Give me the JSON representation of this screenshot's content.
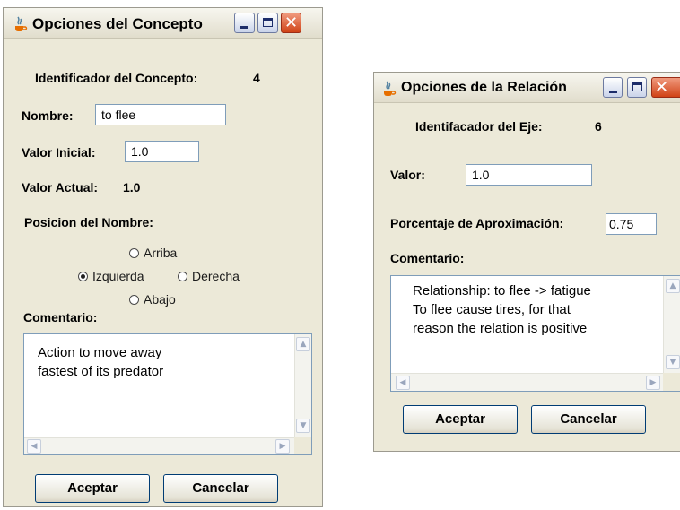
{
  "concept_window": {
    "title": "Opciones del Concepto",
    "id_label": "Identificador del Concepto:",
    "id_value": "4",
    "name_label": "Nombre:",
    "name_value": "to flee",
    "initial_label": "Valor Inicial:",
    "initial_value": "1.0",
    "current_label": "Valor Actual:",
    "current_value": "1.0",
    "position_label": "Posicion del Nombre:",
    "positions": {
      "top": "Arriba",
      "left": "Izquierda",
      "right": "Derecha",
      "bottom": "Abajo"
    },
    "selected_position": "Izquierda",
    "comment_label": "Comentario:",
    "comment_lines": [
      "Action to move away",
      "fastest of its predator"
    ],
    "accept": "Aceptar",
    "cancel": "Cancelar"
  },
  "relation_window": {
    "title": "Opciones de la Relación",
    "id_label": "Identifacador del Eje:",
    "id_value": "6",
    "value_label": "Valor:",
    "value": "1.0",
    "approx_label": "Porcentaje de Aproximación:",
    "approx_value": "0.75",
    "comment_label": "Comentario:",
    "comment_lines": [
      "Relationship: to flee -> fatigue",
      "To flee cause tires, for that",
      "reason the relation is positive"
    ],
    "accept": "Aceptar",
    "cancel": "Cancelar"
  },
  "icons": [
    "java-icon",
    "minimize-icon",
    "maximize-icon",
    "close-icon",
    "scroll-up-icon",
    "scroll-down-icon",
    "scroll-left-icon",
    "scroll-right-icon"
  ]
}
